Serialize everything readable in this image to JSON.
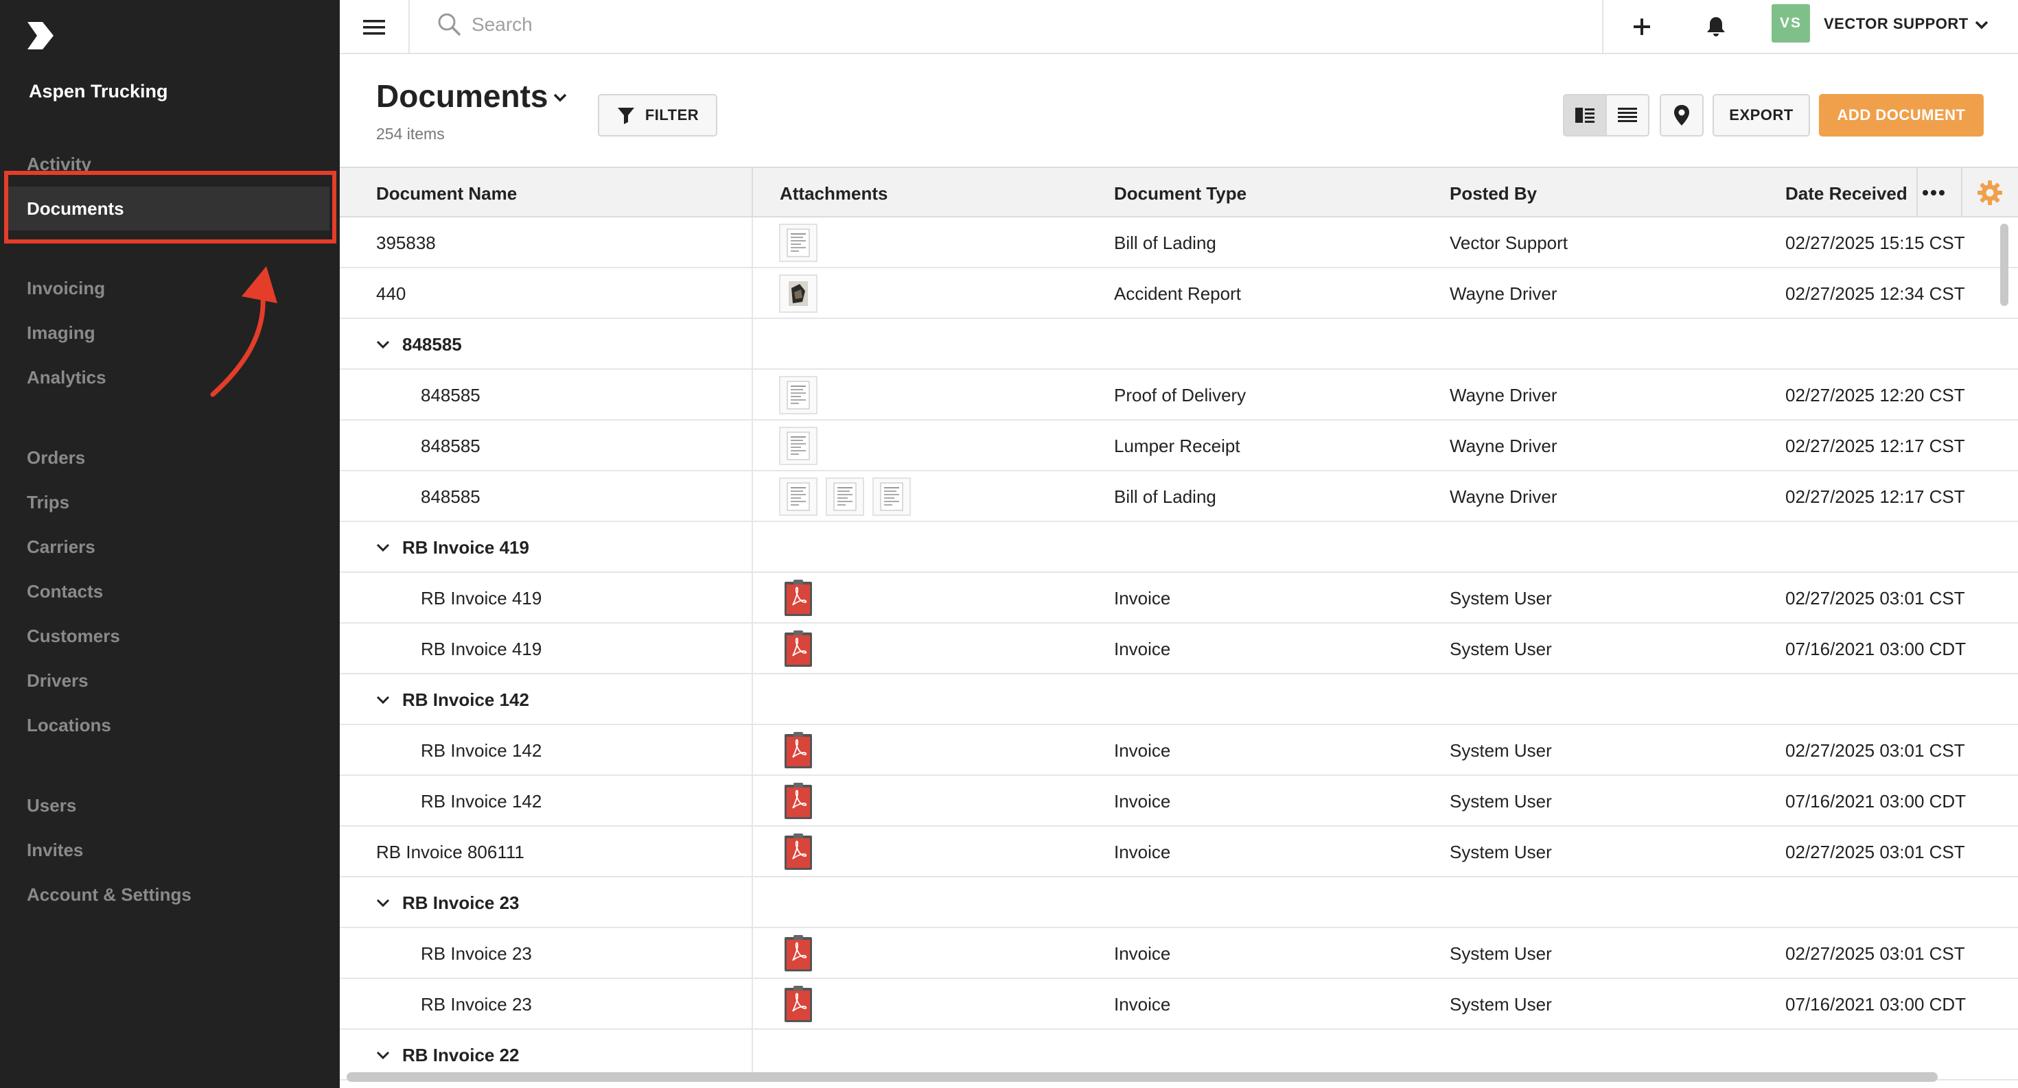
{
  "app": {
    "company": "Aspen Trucking",
    "accent_color": "#f0a04b",
    "highlight_color": "#e43d2a"
  },
  "sidebar": {
    "items": [
      {
        "label": "Activity"
      },
      {
        "label": "Documents"
      },
      {
        "label": "Invoicing"
      },
      {
        "label": "Imaging"
      },
      {
        "label": "Analytics"
      },
      {
        "label": "Orders"
      },
      {
        "label": "Trips"
      },
      {
        "label": "Carriers"
      },
      {
        "label": "Contacts"
      },
      {
        "label": "Customers"
      },
      {
        "label": "Drivers"
      },
      {
        "label": "Locations"
      },
      {
        "label": "Users"
      },
      {
        "label": "Invites"
      },
      {
        "label": "Account & Settings"
      }
    ],
    "active": "Documents"
  },
  "topbar": {
    "search_placeholder": "Search",
    "user_initials": "VS",
    "user_name": "VECTOR SUPPORT"
  },
  "header": {
    "title": "Documents",
    "count": "254 items",
    "filter_label": "FILTER",
    "export_label": "EXPORT",
    "add_label": "ADD DOCUMENT"
  },
  "table": {
    "columns": [
      "Document Name",
      "Attachments",
      "Document Type",
      "Posted By",
      "Date Received"
    ],
    "rows": [
      {
        "kind": "row",
        "name": "395838",
        "indent": false,
        "attachments": [
          "doc"
        ],
        "type": "Bill of Lading",
        "posted_by": "Vector Support",
        "date": "02/27/2025 15:15 CST"
      },
      {
        "kind": "row",
        "name": "440",
        "indent": false,
        "attachments": [
          "photo"
        ],
        "type": "Accident Report",
        "posted_by": "Wayne Driver",
        "date": "02/27/2025 12:34 CST"
      },
      {
        "kind": "group",
        "name": "848585"
      },
      {
        "kind": "row",
        "name": "848585",
        "indent": true,
        "attachments": [
          "doc"
        ],
        "type": "Proof of Delivery",
        "posted_by": "Wayne Driver",
        "date": "02/27/2025 12:20 CST"
      },
      {
        "kind": "row",
        "name": "848585",
        "indent": true,
        "attachments": [
          "doc"
        ],
        "type": "Lumper Receipt",
        "posted_by": "Wayne Driver",
        "date": "02/27/2025 12:17 CST"
      },
      {
        "kind": "row",
        "name": "848585",
        "indent": true,
        "attachments": [
          "doc",
          "doc",
          "doc"
        ],
        "type": "Bill of Lading",
        "posted_by": "Wayne Driver",
        "date": "02/27/2025 12:17 CST"
      },
      {
        "kind": "group",
        "name": "RB Invoice 419"
      },
      {
        "kind": "row",
        "name": "RB Invoice 419",
        "indent": true,
        "attachments": [
          "pdf"
        ],
        "type": "Invoice",
        "posted_by": "System User",
        "date": "02/27/2025 03:01 CST"
      },
      {
        "kind": "row",
        "name": "RB Invoice 419",
        "indent": true,
        "attachments": [
          "pdf"
        ],
        "type": "Invoice",
        "posted_by": "System User",
        "date": "07/16/2021 03:00 CDT"
      },
      {
        "kind": "group",
        "name": "RB Invoice 142"
      },
      {
        "kind": "row",
        "name": "RB Invoice 142",
        "indent": true,
        "attachments": [
          "pdf"
        ],
        "type": "Invoice",
        "posted_by": "System User",
        "date": "02/27/2025 03:01 CST"
      },
      {
        "kind": "row",
        "name": "RB Invoice 142",
        "indent": true,
        "attachments": [
          "pdf"
        ],
        "type": "Invoice",
        "posted_by": "System User",
        "date": "07/16/2021 03:00 CDT"
      },
      {
        "kind": "row",
        "name": "RB Invoice 806111",
        "indent": false,
        "attachments": [
          "pdf"
        ],
        "type": "Invoice",
        "posted_by": "System User",
        "date": "02/27/2025 03:01 CST"
      },
      {
        "kind": "group",
        "name": "RB Invoice 23"
      },
      {
        "kind": "row",
        "name": "RB Invoice 23",
        "indent": true,
        "attachments": [
          "pdf"
        ],
        "type": "Invoice",
        "posted_by": "System User",
        "date": "02/27/2025 03:01 CST"
      },
      {
        "kind": "row",
        "name": "RB Invoice 23",
        "indent": true,
        "attachments": [
          "pdf"
        ],
        "type": "Invoice",
        "posted_by": "System User",
        "date": "07/16/2021 03:00 CDT"
      },
      {
        "kind": "group",
        "name": "RB Invoice 22"
      }
    ]
  }
}
